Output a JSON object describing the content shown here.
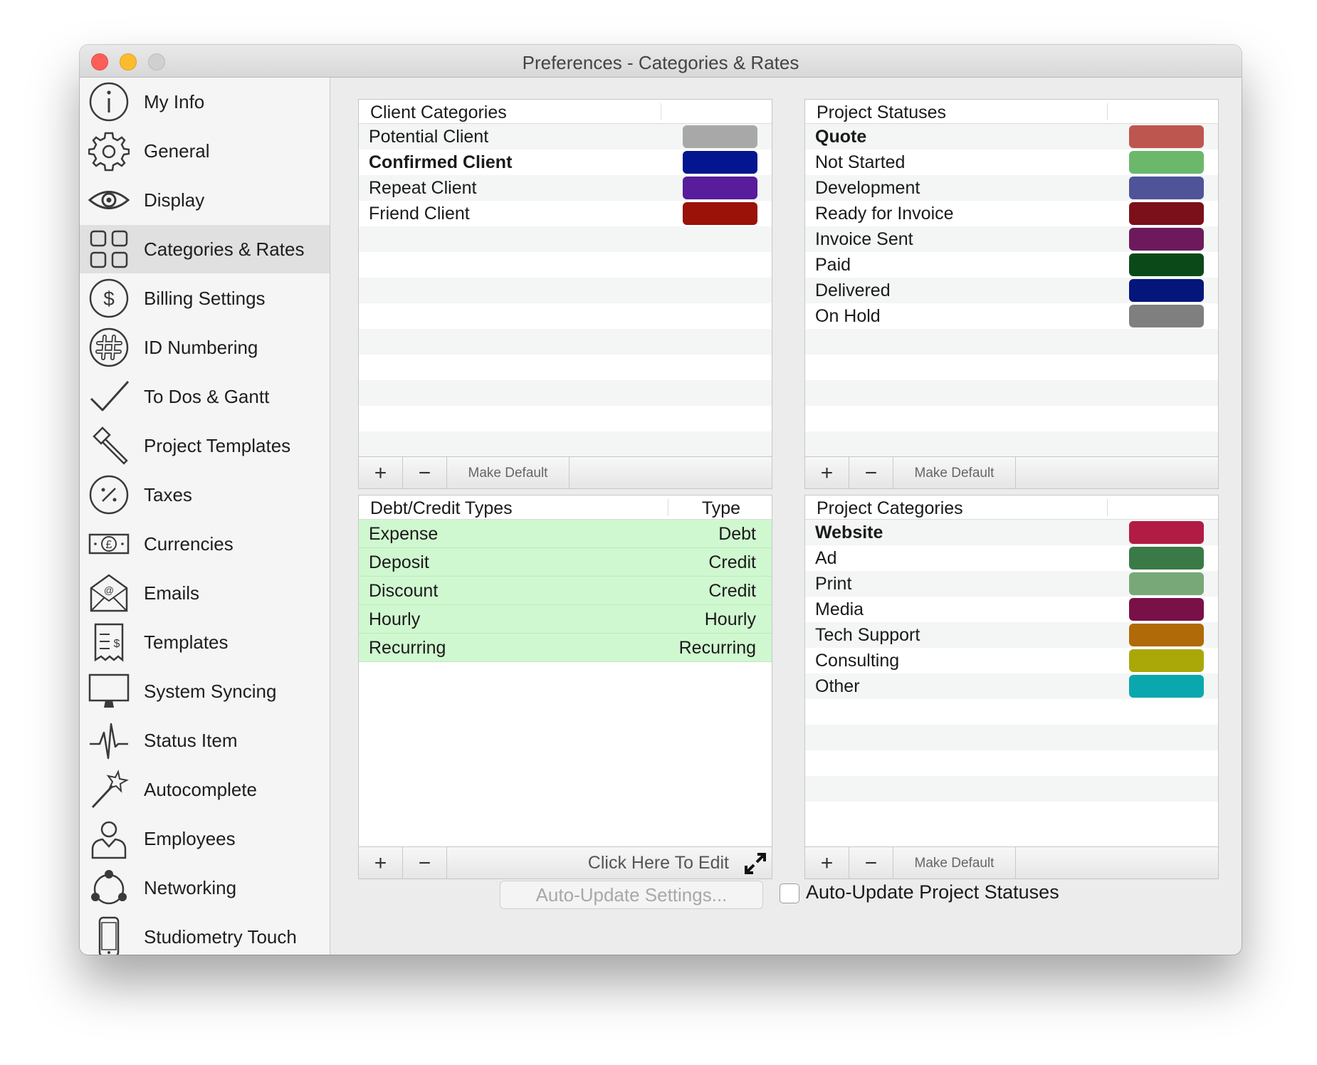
{
  "window": {
    "title": "Preferences - Categories & Rates"
  },
  "sidebar": {
    "items": [
      {
        "label": "My Info",
        "icon": "info-icon",
        "active": false
      },
      {
        "label": "General",
        "icon": "gear-icon",
        "active": false
      },
      {
        "label": "Display",
        "icon": "eye-icon",
        "active": false
      },
      {
        "label": "Categories & Rates",
        "icon": "grid-icon",
        "active": true
      },
      {
        "label": "Billing Settings",
        "icon": "dollar-icon",
        "active": false
      },
      {
        "label": "ID Numbering",
        "icon": "hash-icon",
        "active": false
      },
      {
        "label": "To Dos & Gantt",
        "icon": "checkmark-icon",
        "active": false
      },
      {
        "label": "Project Templates",
        "icon": "hammer-icon",
        "active": false
      },
      {
        "label": "Taxes",
        "icon": "percent-icon",
        "active": false
      },
      {
        "label": "Currencies",
        "icon": "banknote-icon",
        "active": false
      },
      {
        "label": "Emails",
        "icon": "envelope-icon",
        "active": false
      },
      {
        "label": "Templates",
        "icon": "receipt-icon",
        "active": false
      },
      {
        "label": "System Syncing",
        "icon": "monitor-icon",
        "active": false
      },
      {
        "label": "Status Item",
        "icon": "pulse-icon",
        "active": false
      },
      {
        "label": "Autocomplete",
        "icon": "magic-wand-icon",
        "active": false
      },
      {
        "label": "Employees",
        "icon": "person-icon",
        "active": false
      },
      {
        "label": "Networking",
        "icon": "network-icon",
        "active": false
      },
      {
        "label": "Studiometry Touch",
        "icon": "phone-icon",
        "active": false
      }
    ]
  },
  "client_categories": {
    "header": "Client Categories",
    "rows": [
      {
        "label": "Potential Client",
        "color": "#a8a8a8",
        "bold": false
      },
      {
        "label": "Confirmed Client",
        "color": "#04168f",
        "bold": true
      },
      {
        "label": "Repeat Client",
        "color": "#581c9c",
        "bold": false
      },
      {
        "label": "Friend Client",
        "color": "#9a1208",
        "bold": false
      }
    ],
    "footer": {
      "plus": "+",
      "minus": "−",
      "default_label": "Make Default"
    }
  },
  "project_statuses": {
    "header": "Project Statuses",
    "rows": [
      {
        "label": "Quote",
        "color": "#be5650",
        "bold": true
      },
      {
        "label": "Not Started",
        "color": "#6cb86b",
        "bold": false
      },
      {
        "label": "Development",
        "color": "#4f5499",
        "bold": false
      },
      {
        "label": "Ready for Invoice",
        "color": "#7c101a",
        "bold": false
      },
      {
        "label": "Invoice Sent",
        "color": "#6c1a5c",
        "bold": false
      },
      {
        "label": "Paid",
        "color": "#0b4a18",
        "bold": false
      },
      {
        "label": "Delivered",
        "color": "#05167a",
        "bold": false
      },
      {
        "label": "On Hold",
        "color": "#7f7f7f",
        "bold": false
      }
    ],
    "footer": {
      "plus": "+",
      "minus": "−",
      "default_label": "Make Default"
    }
  },
  "debt_credit": {
    "header": "Debt/Credit Types",
    "type_header": "Type",
    "rows": [
      {
        "label": "Expense",
        "type": "Debt"
      },
      {
        "label": "Deposit",
        "type": "Credit"
      },
      {
        "label": "Discount",
        "type": "Credit"
      },
      {
        "label": "Hourly",
        "type": "Hourly"
      },
      {
        "label": "Recurring",
        "type": "Recurring"
      }
    ],
    "footer": {
      "plus": "+",
      "minus": "−",
      "edit_label": "Click Here To Edit"
    }
  },
  "project_categories": {
    "header": "Project Categories",
    "rows": [
      {
        "label": "Website",
        "color": "#b01c44",
        "bold": true
      },
      {
        "label": "Ad",
        "color": "#3a7a47",
        "bold": false
      },
      {
        "label": "Print",
        "color": "#78a878",
        "bold": false
      },
      {
        "label": "Media",
        "color": "#7a1048",
        "bold": false
      },
      {
        "label": "Tech Support",
        "color": "#b06a08",
        "bold": false
      },
      {
        "label": "Consulting",
        "color": "#aaa808",
        "bold": false
      },
      {
        "label": "Other",
        "color": "#0aa8ae",
        "bold": false
      }
    ],
    "footer": {
      "plus": "+",
      "minus": "−",
      "default_label": "Make Default"
    }
  },
  "auto_update": {
    "button_label": "Auto-Update Settings...",
    "checkbox_label": "Auto-Update Project Statuses",
    "checked": false
  }
}
